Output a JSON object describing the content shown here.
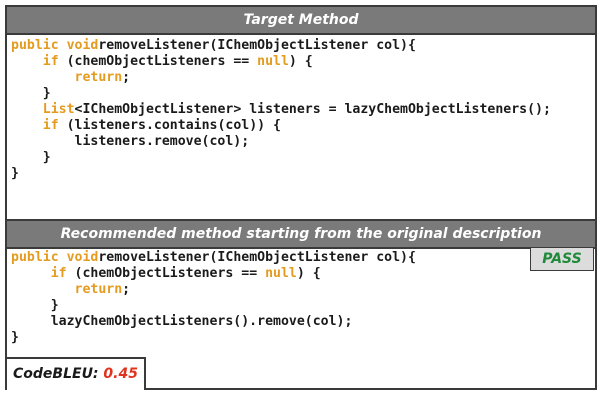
{
  "target_header": "Target Method",
  "target_code": [
    [
      [
        "kw",
        "public void"
      ],
      [
        "",
        "removeListener(IChemObjectListener col){"
      ]
    ],
    [
      [
        "",
        "    "
      ],
      [
        "kw",
        "if"
      ],
      [
        "",
        " (chemObjectListeners == "
      ],
      [
        "kw",
        "null"
      ],
      [
        "",
        ") {"
      ]
    ],
    [
      [
        "",
        "        "
      ],
      [
        "kw",
        "return"
      ],
      [
        "",
        ";"
      ]
    ],
    [
      [
        "",
        "    }"
      ]
    ],
    [
      [
        "",
        "    "
      ],
      [
        "kw",
        "List"
      ],
      [
        "",
        "<IChemObjectListener> listeners = lazyChemObjectListeners();"
      ]
    ],
    [
      [
        "",
        "    "
      ],
      [
        "kw",
        "if"
      ],
      [
        "",
        " (listeners.contains(col)) {"
      ]
    ],
    [
      [
        "",
        "        listeners.remove(col);"
      ]
    ],
    [
      [
        "",
        "    }"
      ]
    ],
    [
      [
        "",
        "}"
      ]
    ]
  ],
  "recommended_header": "Recommended method starting from the original description",
  "recommended_code": [
    [
      [
        "kw",
        "public void"
      ],
      [
        "",
        "removeListener(IChemObjectListener col){"
      ]
    ],
    [
      [
        "",
        "     "
      ],
      [
        "kw",
        "if"
      ],
      [
        "",
        " (chemObjectListeners == "
      ],
      [
        "kw",
        "null"
      ],
      [
        "",
        ") {"
      ]
    ],
    [
      [
        "",
        "        "
      ],
      [
        "kw",
        "return"
      ],
      [
        "",
        ";"
      ]
    ],
    [
      [
        "",
        "     }"
      ]
    ],
    [
      [
        "",
        "     lazyChemObjectListeners().remove(col);"
      ]
    ],
    [
      [
        "",
        "}"
      ]
    ]
  ],
  "result_badge": "PASS",
  "codebleu_label": "CodeBLEU:",
  "codebleu_value": "0.45",
  "colors": {
    "keyword": "#e49b1f",
    "pass": "#1f8a3a",
    "score": "#e0341e",
    "header_bg": "#7a7a7a"
  }
}
